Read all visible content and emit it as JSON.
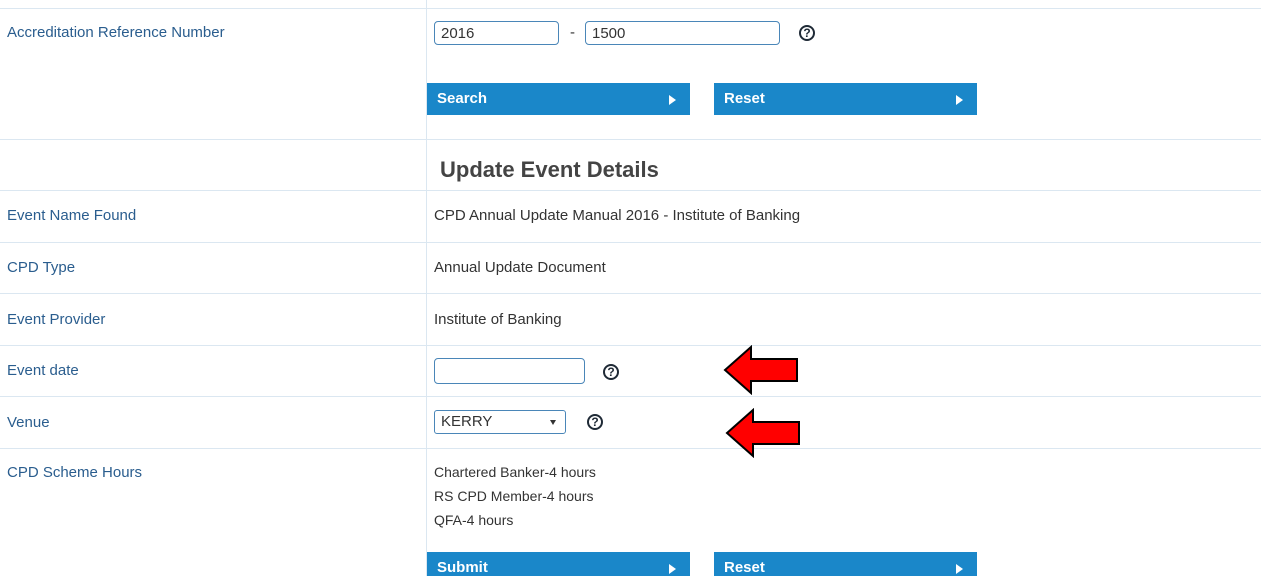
{
  "search": {
    "accreditation_label": "Accreditation Reference Number",
    "ref_part1": "2016",
    "ref_separator": "-",
    "ref_part2": "1500",
    "search_button": "Search",
    "reset_button": "Reset"
  },
  "update": {
    "heading": "Update Event Details",
    "event_name_label": "Event Name Found",
    "event_name_value": "CPD Annual Update Manual 2016 - Institute of Banking",
    "cpd_type_label": "CPD Type",
    "cpd_type_value": "Annual Update Document",
    "provider_label": "Event Provider",
    "provider_value": "Institute of Banking",
    "event_date_label": "Event date",
    "event_date_value": "",
    "venue_label": "Venue",
    "venue_value": "KERRY",
    "scheme_hours_label": "CPD Scheme Hours",
    "scheme_hours": [
      "Chartered Banker-4 hours",
      "RS CPD Member-4 hours",
      "QFA-4 hours"
    ],
    "submit_button": "Submit",
    "reset_button": "Reset"
  },
  "help_glyph": "?",
  "colors": {
    "button": "#1a87c9",
    "label": "#2a5d8e",
    "arrow": "#ff0000"
  },
  "icons": {
    "help": "help-circle-icon",
    "button_arrow": "triangle-right-icon",
    "annotation": "red-arrow-left-icon"
  }
}
